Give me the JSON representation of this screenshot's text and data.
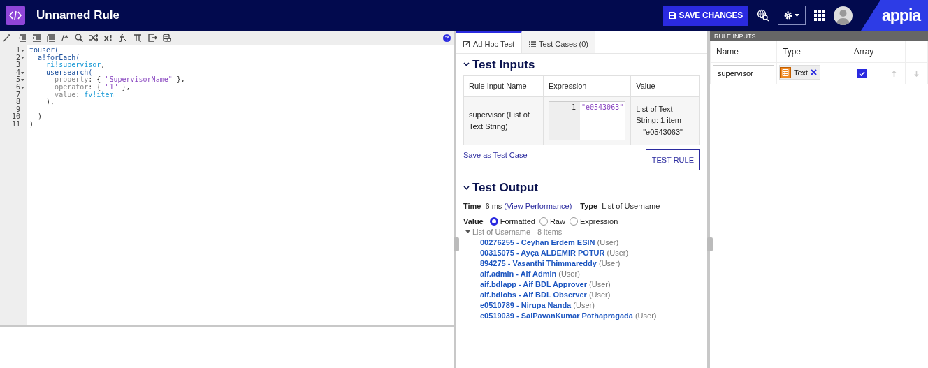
{
  "header": {
    "title": "Unnamed Rule",
    "save_button": "SAVE CHANGES",
    "logo": "appia"
  },
  "toolbar": [
    {
      "kind": "wand"
    },
    {
      "kind": "outdent"
    },
    {
      "kind": "indent"
    },
    {
      "kind": "format"
    },
    {
      "kind": "glyph",
      "text": "/*"
    },
    {
      "kind": "search"
    },
    {
      "kind": "shuffle"
    },
    {
      "kind": "glyph",
      "text": "x!"
    },
    {
      "kind": "function"
    },
    {
      "kind": "pi"
    },
    {
      "kind": "export"
    },
    {
      "kind": "database"
    }
  ],
  "code_lines": [
    {
      "number": "1",
      "foldable": true,
      "tokens": [
        {
          "kind": "fn",
          "text": "touser("
        }
      ]
    },
    {
      "number": "2",
      "foldable": true,
      "tokens": [
        {
          "kind": "fn",
          "text": "  a!forEach("
        }
      ]
    },
    {
      "number": "3",
      "foldable": false,
      "tokens": [
        {
          "kind": "ref",
          "text": "    ri!supervisor"
        },
        {
          "kind": "punct",
          "text": ","
        }
      ]
    },
    {
      "number": "4",
      "foldable": true,
      "tokens": [
        {
          "kind": "fn",
          "text": "    usersearch("
        }
      ]
    },
    {
      "number": "5",
      "foldable": true,
      "tokens": [
        {
          "kind": "key",
          "text": "      property"
        },
        {
          "kind": "punct",
          "text": ": { "
        },
        {
          "kind": "str",
          "text": "\"SupervisorName\""
        },
        {
          "kind": "punct",
          "text": " },"
        }
      ]
    },
    {
      "number": "6",
      "foldable": true,
      "tokens": [
        {
          "kind": "key",
          "text": "      operator"
        },
        {
          "kind": "punct",
          "text": ": { "
        },
        {
          "kind": "str",
          "text": "\"1\""
        },
        {
          "kind": "punct",
          "text": " },"
        }
      ]
    },
    {
      "number": "7",
      "foldable": false,
      "tokens": [
        {
          "kind": "key",
          "text": "      value"
        },
        {
          "kind": "punct",
          "text": ": "
        },
        {
          "kind": "ref",
          "text": "fv!item"
        }
      ]
    },
    {
      "number": "8",
      "foldable": false,
      "tokens": [
        {
          "kind": "punct",
          "text": "    ),"
        }
      ]
    },
    {
      "number": "9",
      "foldable": false
    },
    {
      "number": "10",
      "foldable": false,
      "tokens": [
        {
          "kind": "punct",
          "text": "  )"
        }
      ]
    },
    {
      "number": "11",
      "foldable": false,
      "tokens": [
        {
          "kind": "punct",
          "text": ")"
        }
      ]
    }
  ],
  "test_tabs": [
    {
      "label": "Ad Hoc Test",
      "kind": "edit",
      "selected": true
    },
    {
      "label": "Test Cases (0)",
      "kind": "list",
      "selected": false
    }
  ],
  "test_inputs": {
    "title": "Test Inputs",
    "columns": [
      "Rule Input Name",
      "Expression",
      "Value"
    ],
    "rows": [
      {
        "name": "supervisor (List of Text String)",
        "expression_line": "1",
        "expression": "\"e0543063\"",
        "value": "List of Text String: 1 item",
        "value_item": "\"e0543063\""
      }
    ],
    "save_link": "Save as Test Case",
    "test_button": "TEST RULE"
  },
  "test_output": {
    "title": "Test Output",
    "time_label": "Time",
    "time": "6 ms",
    "performance_link": "(View Performance)",
    "type_label": "Type",
    "type": "List of Username",
    "value_label": "Value",
    "formats": [
      {
        "label": "Formatted",
        "selected": true
      },
      {
        "label": "Raw",
        "selected": false
      },
      {
        "label": "Expression",
        "selected": false
      }
    ],
    "list_title": "List of Username - 8 items",
    "expanded": true,
    "items": [
      {
        "text": "00276255 - Ceyhan Erdem ESIN",
        "suffix": "(User)"
      },
      {
        "text": "00315075 - Ayça ALDEMIR POTUR",
        "suffix": "(User)"
      },
      {
        "text": "894275 - Vasanthi Thimmareddy",
        "suffix": "(User)"
      },
      {
        "text": "aif.admin - Aif Admin",
        "suffix": "(User)"
      },
      {
        "text": "aif.bdlapp - Aif BDL Approver",
        "suffix": "(User)"
      },
      {
        "text": "aif.bdlobs - Aif BDL Observer",
        "suffix": "(User)"
      },
      {
        "text": "e0510789 - Nirupa Nanda",
        "suffix": "(User)"
      },
      {
        "text": "e0519039 - SaiPavanKumar Pothapragada",
        "suffix": "(User)"
      }
    ]
  },
  "rule_inputs": {
    "title": "RULE INPUTS",
    "columns": [
      "Name",
      "Type",
      "Array"
    ],
    "rows": [
      {
        "name": "supervisor",
        "type": "Text",
        "array": true
      }
    ]
  }
}
